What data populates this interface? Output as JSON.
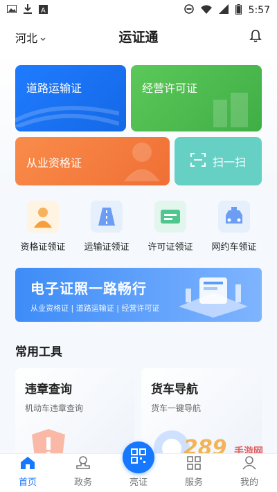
{
  "status_bar": {
    "time": "5:57"
  },
  "header": {
    "region": "河北",
    "title": "运证通"
  },
  "cards": {
    "road_transport": "道路运输证",
    "business_license": "经营许可证",
    "qualification": "从业资格证",
    "scan": "扫一扫"
  },
  "quick_actions": [
    {
      "label": "资格证领证"
    },
    {
      "label": "运输证领证"
    },
    {
      "label": "许可证领证"
    },
    {
      "label": "网约车领证"
    }
  ],
  "banner": {
    "title": "电子证照一路畅行",
    "subtitle": "从业资格证 | 道路运输证 | 经营许可证"
  },
  "section_title": "常用工具",
  "tools": [
    {
      "title": "违章查询",
      "subtitle": "机动车违章查询"
    },
    {
      "title": "货车导航",
      "subtitle": "货车一键导航"
    }
  ],
  "tabbar": [
    {
      "label": "首页"
    },
    {
      "label": "政务"
    },
    {
      "label": "亮证"
    },
    {
      "label": "服务"
    },
    {
      "label": "我的"
    }
  ],
  "watermark": {
    "text": "289",
    "suffix": "手游网"
  },
  "colors": {
    "accent": "#1677ff",
    "green": "#4cbb4f",
    "orange": "#f47d3f",
    "teal": "#67d0c5"
  }
}
